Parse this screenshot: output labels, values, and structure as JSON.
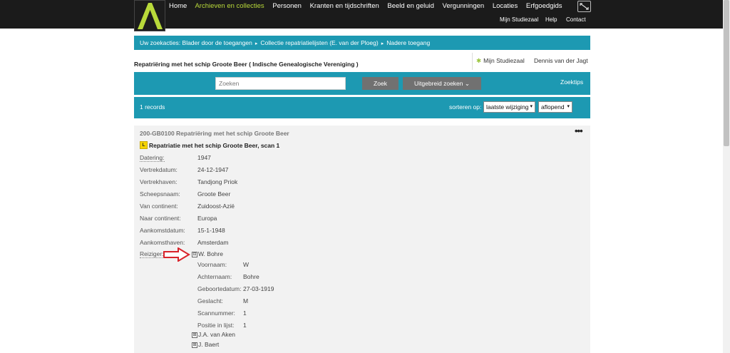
{
  "nav": {
    "items": [
      {
        "label": "Home",
        "active": false
      },
      {
        "label": "Archieven en collecties",
        "active": true
      },
      {
        "label": "Personen",
        "active": false
      },
      {
        "label": "Kranten en tijdschriften",
        "active": false
      },
      {
        "label": "Beeld en geluid",
        "active": false
      },
      {
        "label": "Vergunningen",
        "active": false
      },
      {
        "label": "Locaties",
        "active": false
      },
      {
        "label": "Erfgoedgids",
        "active": false
      }
    ],
    "sub": [
      "Mijn Studiezaal",
      "Help",
      "Contact"
    ]
  },
  "breadcrumb": [
    "Uw zoekacties: Blader door de toegangen",
    "Collectie repatriatielijsten (E. van der Ploeg)",
    "Nadere toegang"
  ],
  "title_row": {
    "page_title": "Repatriëring met het schip Groote Beer ( Indische Genealogische Vereniging )",
    "studiezaal_label": "Mijn Studiezaal",
    "user_name": "Dennis van der Jagt"
  },
  "search": {
    "placeholder": "Zoeken",
    "value": "",
    "button_label": "Zoek",
    "advanced_label": "Uitgebreid zoeken",
    "tips_label": "Zoektips"
  },
  "results": {
    "count_label": "1 records",
    "sort_label": "sorteren op:",
    "sort_field": "laatste wijziging",
    "sort_order": "aflopend"
  },
  "record": {
    "header": "200-GB0100 Repatriëring met het schip Groote Beer",
    "badge": "L",
    "subtitle": "Repatriatie met het schip Groote Beer, scan 1",
    "fields": [
      {
        "label": "Datering:",
        "value": "1947"
      },
      {
        "label": "Vertrekdatum:",
        "value": "24-12-1947"
      },
      {
        "label": "Vertrekhaven:",
        "value": "Tandjong Priok"
      },
      {
        "label": "Scheepsnaam:",
        "value": "Groote Beer"
      },
      {
        "label": "Van continent:",
        "value": "Zuidoost-Azië"
      },
      {
        "label": "Naar continent:",
        "value": "Europa"
      },
      {
        "label": "Aankomstdatum:",
        "value": "15-1-1948"
      },
      {
        "label": "Aankomsthaven:",
        "value": "Amsterdam"
      }
    ],
    "traveler_label": "Reiziger:",
    "expanded_traveler": {
      "name": "W. Bohre",
      "toggle": "⊟",
      "details": [
        {
          "label": "Voornaam:",
          "value": "W"
        },
        {
          "label": "Achternaam:",
          "value": "Bohre"
        },
        {
          "label": "Geboortedatum:",
          "value": "27-03-1919"
        },
        {
          "label": "Geslacht:",
          "value": "M"
        },
        {
          "label": "Scannummer:",
          "value": "1"
        },
        {
          "label": "Positie in lijst:",
          "value": "1"
        }
      ]
    },
    "collapsed_travelers": [
      {
        "name": "J.A. van Aken",
        "toggle": "⊞"
      },
      {
        "name": "J. Baert",
        "toggle": "⊞"
      }
    ]
  },
  "colors": {
    "accent": "#1d99b2",
    "nav_bg": "#1b1b1b",
    "active_nav": "#b8d93a",
    "annotation_arrow": "#d9242b"
  }
}
